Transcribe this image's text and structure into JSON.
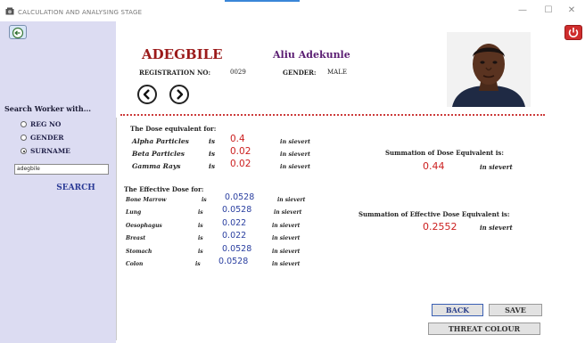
{
  "window": {
    "title": "CALCULATION AND ANALYSING STAGE",
    "minimize": "—",
    "maximize": "☐",
    "close": "✕"
  },
  "worker": {
    "first_name": "ADEGBILE",
    "surname": "Aliu Adekunle",
    "reg_label": "REGISTRATION NO:",
    "reg_no": "0029",
    "gender_label": "GENDER:",
    "gender": "MALE"
  },
  "search": {
    "title": "Search Worker with...",
    "options": [
      {
        "label": "REG NO",
        "checked": false
      },
      {
        "label": "GENDER",
        "checked": false
      },
      {
        "label": "SURNAME",
        "checked": true
      }
    ],
    "input_value": "adegbile",
    "button_label": "SEARCH"
  },
  "dose_equivalent": {
    "title": "The Dose equivalent for:",
    "rows": [
      {
        "label": "Alpha Particles",
        "is": "is",
        "value": "0.4",
        "unit": "in sievert"
      },
      {
        "label": "Beta Particles",
        "is": "is",
        "value": "0.02",
        "unit": "in sievert"
      },
      {
        "label": "Gamma Rays",
        "is": "is",
        "value": "0.02",
        "unit": "in sievert"
      }
    ],
    "summation_title": "Summation of Dose Equivalent is:",
    "summation_value": "0.44",
    "summation_unit": "in sievert"
  },
  "effective_dose": {
    "title": "The Effective Dose for:",
    "rows": [
      {
        "label": "Bone Marrow",
        "is": "is",
        "value": "0.0528",
        "unit": "in sievert"
      },
      {
        "label": "Lung",
        "is": "is",
        "value": "0.0528",
        "unit": "in sievert"
      },
      {
        "label": "Oesophagus",
        "is": "is",
        "value": "0.022",
        "unit": "in sievert"
      },
      {
        "label": "Breast",
        "is": "is",
        "value": "0.022",
        "unit": "in sievert"
      },
      {
        "label": "Stomach",
        "is": "is",
        "value": "0.0528",
        "unit": "in sievert"
      },
      {
        "label": "Colon",
        "is": "is",
        "value": "0.0528",
        "unit": "in sievert"
      }
    ],
    "summation_title": "Summation of Effective Dose Equivalent is:",
    "summation_value": "0.2552",
    "summation_unit": "in sievert"
  },
  "buttons": {
    "back": "BACK",
    "save": "SAVE",
    "threat": "THREAT COLOUR"
  },
  "colors": {
    "sidebar_bg": "#dcdcf2",
    "dose_value": "#cc2020",
    "effective_value": "#2a3fa0",
    "name_red": "#9b1a1a",
    "name_purple": "#5a1d72",
    "separator": "#cc3b3b"
  }
}
